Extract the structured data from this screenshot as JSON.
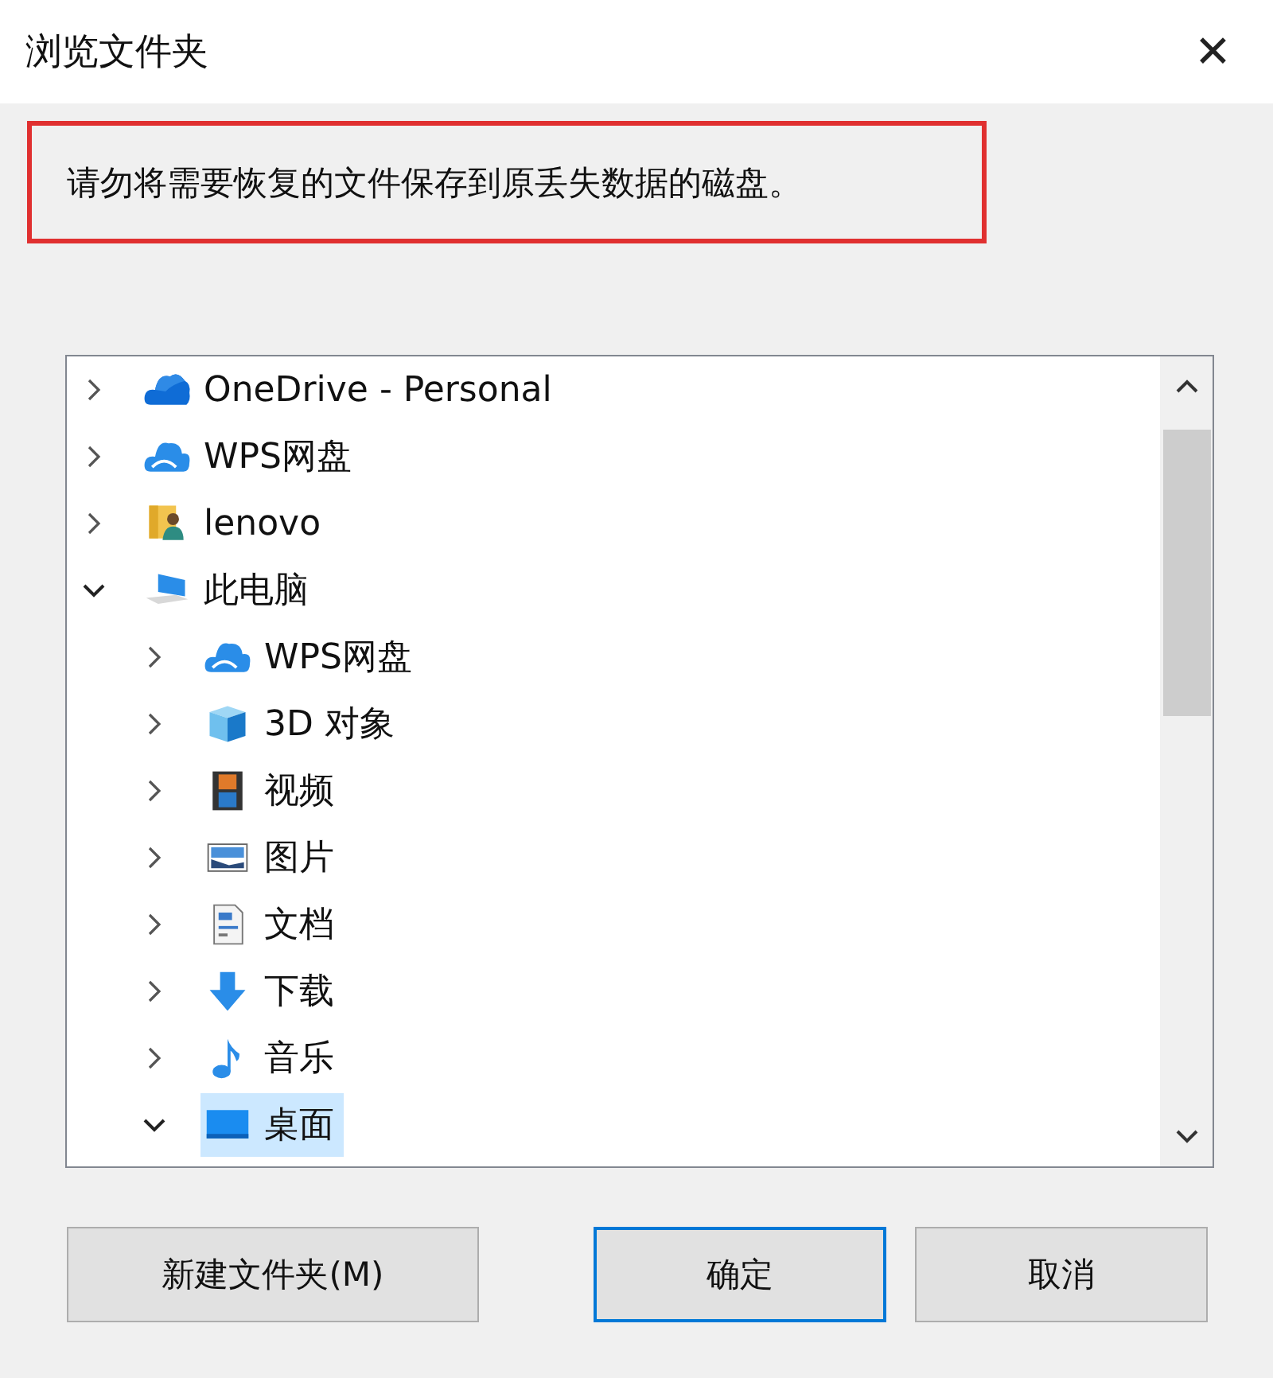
{
  "window": {
    "title": "浏览文件夹",
    "close": "✕"
  },
  "message": "请勿将需要恢复的文件保存到原丢失数据的磁盘。",
  "tree": [
    {
      "label": "OneDrive - Personal",
      "expanded": false,
      "selected": false
    },
    {
      "label": "WPS网盘",
      "expanded": false,
      "selected": false
    },
    {
      "label": "lenovo",
      "expanded": false,
      "selected": false
    },
    {
      "label": "此电脑",
      "expanded": true,
      "selected": false,
      "children": [
        {
          "label": "WPS网盘",
          "expanded": false,
          "selected": false
        },
        {
          "label": "3D 对象",
          "expanded": false,
          "selected": false
        },
        {
          "label": "视频",
          "expanded": false,
          "selected": false
        },
        {
          "label": "图片",
          "expanded": false,
          "selected": false
        },
        {
          "label": "文档",
          "expanded": false,
          "selected": false
        },
        {
          "label": "下载",
          "expanded": false,
          "selected": false
        },
        {
          "label": "音乐",
          "expanded": false,
          "selected": false
        },
        {
          "label": "桌面",
          "expanded": true,
          "selected": true
        }
      ]
    }
  ],
  "buttons": [
    {
      "label": "新建文件夹(M)",
      "default": false
    },
    {
      "label": "确定",
      "default": true
    },
    {
      "label": "取消",
      "default": false
    }
  ]
}
